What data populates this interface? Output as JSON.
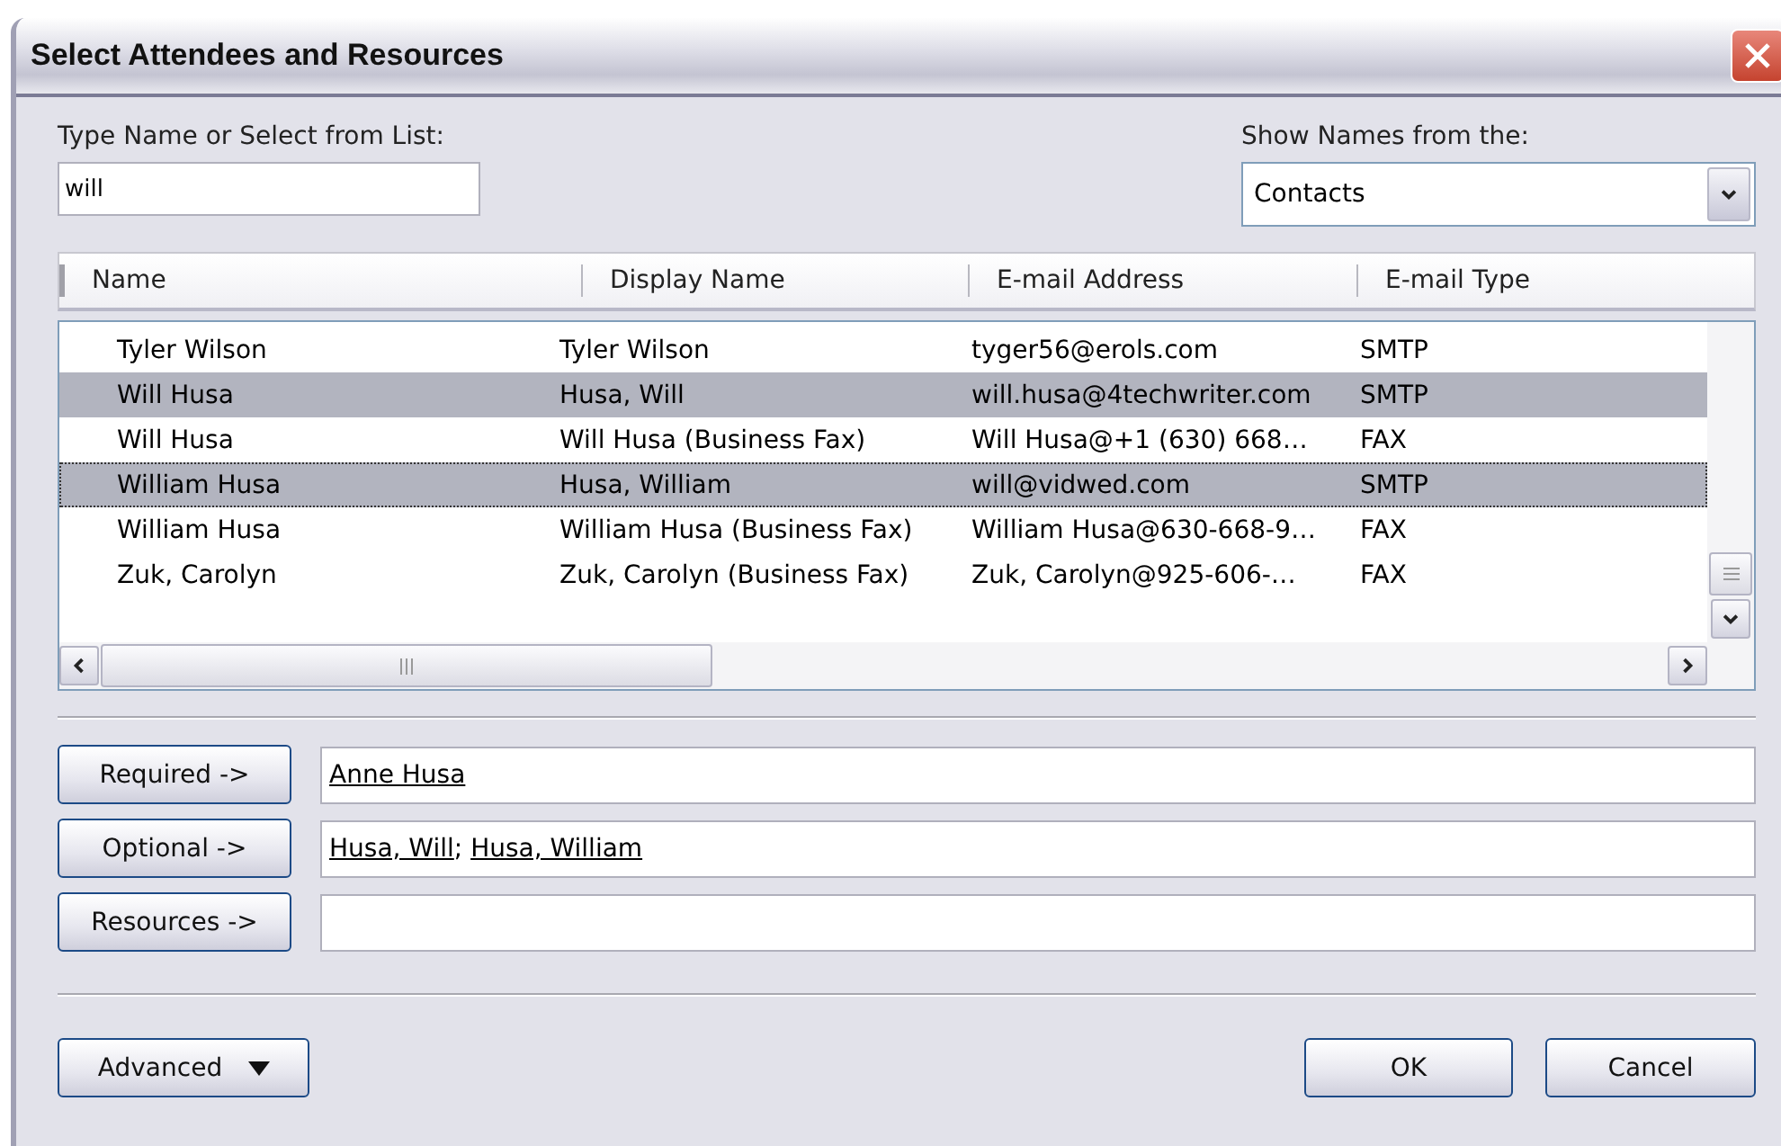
{
  "window": {
    "title": "Select Attendees and Resources"
  },
  "search": {
    "label": "Type Name or Select from List:",
    "value": "will"
  },
  "address_book": {
    "label": "Show Names from the:",
    "value": "Contacts"
  },
  "table": {
    "columns": [
      "Name",
      "Display Name",
      "E-mail Address",
      "E-mail Type"
    ],
    "rows": [
      {
        "cells": [
          "Tyler Wilson",
          "Tyler Wilson",
          "tyger56@erols.com",
          "SMTP"
        ],
        "selected": false,
        "focused": false
      },
      {
        "cells": [
          "Will Husa",
          "Husa, Will",
          "will.husa@4techwriter.com",
          "SMTP"
        ],
        "selected": true,
        "focused": false
      },
      {
        "cells": [
          "Will Husa",
          "Will Husa (Business Fax)",
          "Will Husa@+1 (630) 668…",
          "FAX"
        ],
        "selected": false,
        "focused": false
      },
      {
        "cells": [
          "William Husa",
          "Husa, William",
          "will@vidwed.com",
          "SMTP"
        ],
        "selected": true,
        "focused": true
      },
      {
        "cells": [
          "William Husa",
          "William Husa (Business Fax)",
          "William Husa@630-668-9…",
          "FAX"
        ],
        "selected": false,
        "focused": false
      },
      {
        "cells": [
          "Zuk, Carolyn",
          "Zuk, Carolyn (Business Fax)",
          "Zuk, Carolyn@925-606-…",
          "FAX"
        ],
        "selected": false,
        "focused": false
      }
    ]
  },
  "attendees": [
    {
      "button": "Required ->",
      "entries": [
        "Anne Husa"
      ]
    },
    {
      "button": "Optional ->",
      "separator": "; ",
      "entries": [
        "Husa, Will",
        "Husa, William"
      ]
    },
    {
      "button": "Resources ->"
    }
  ],
  "footer": {
    "advanced": "Advanced",
    "ok": "OK",
    "cancel": "Cancel"
  }
}
